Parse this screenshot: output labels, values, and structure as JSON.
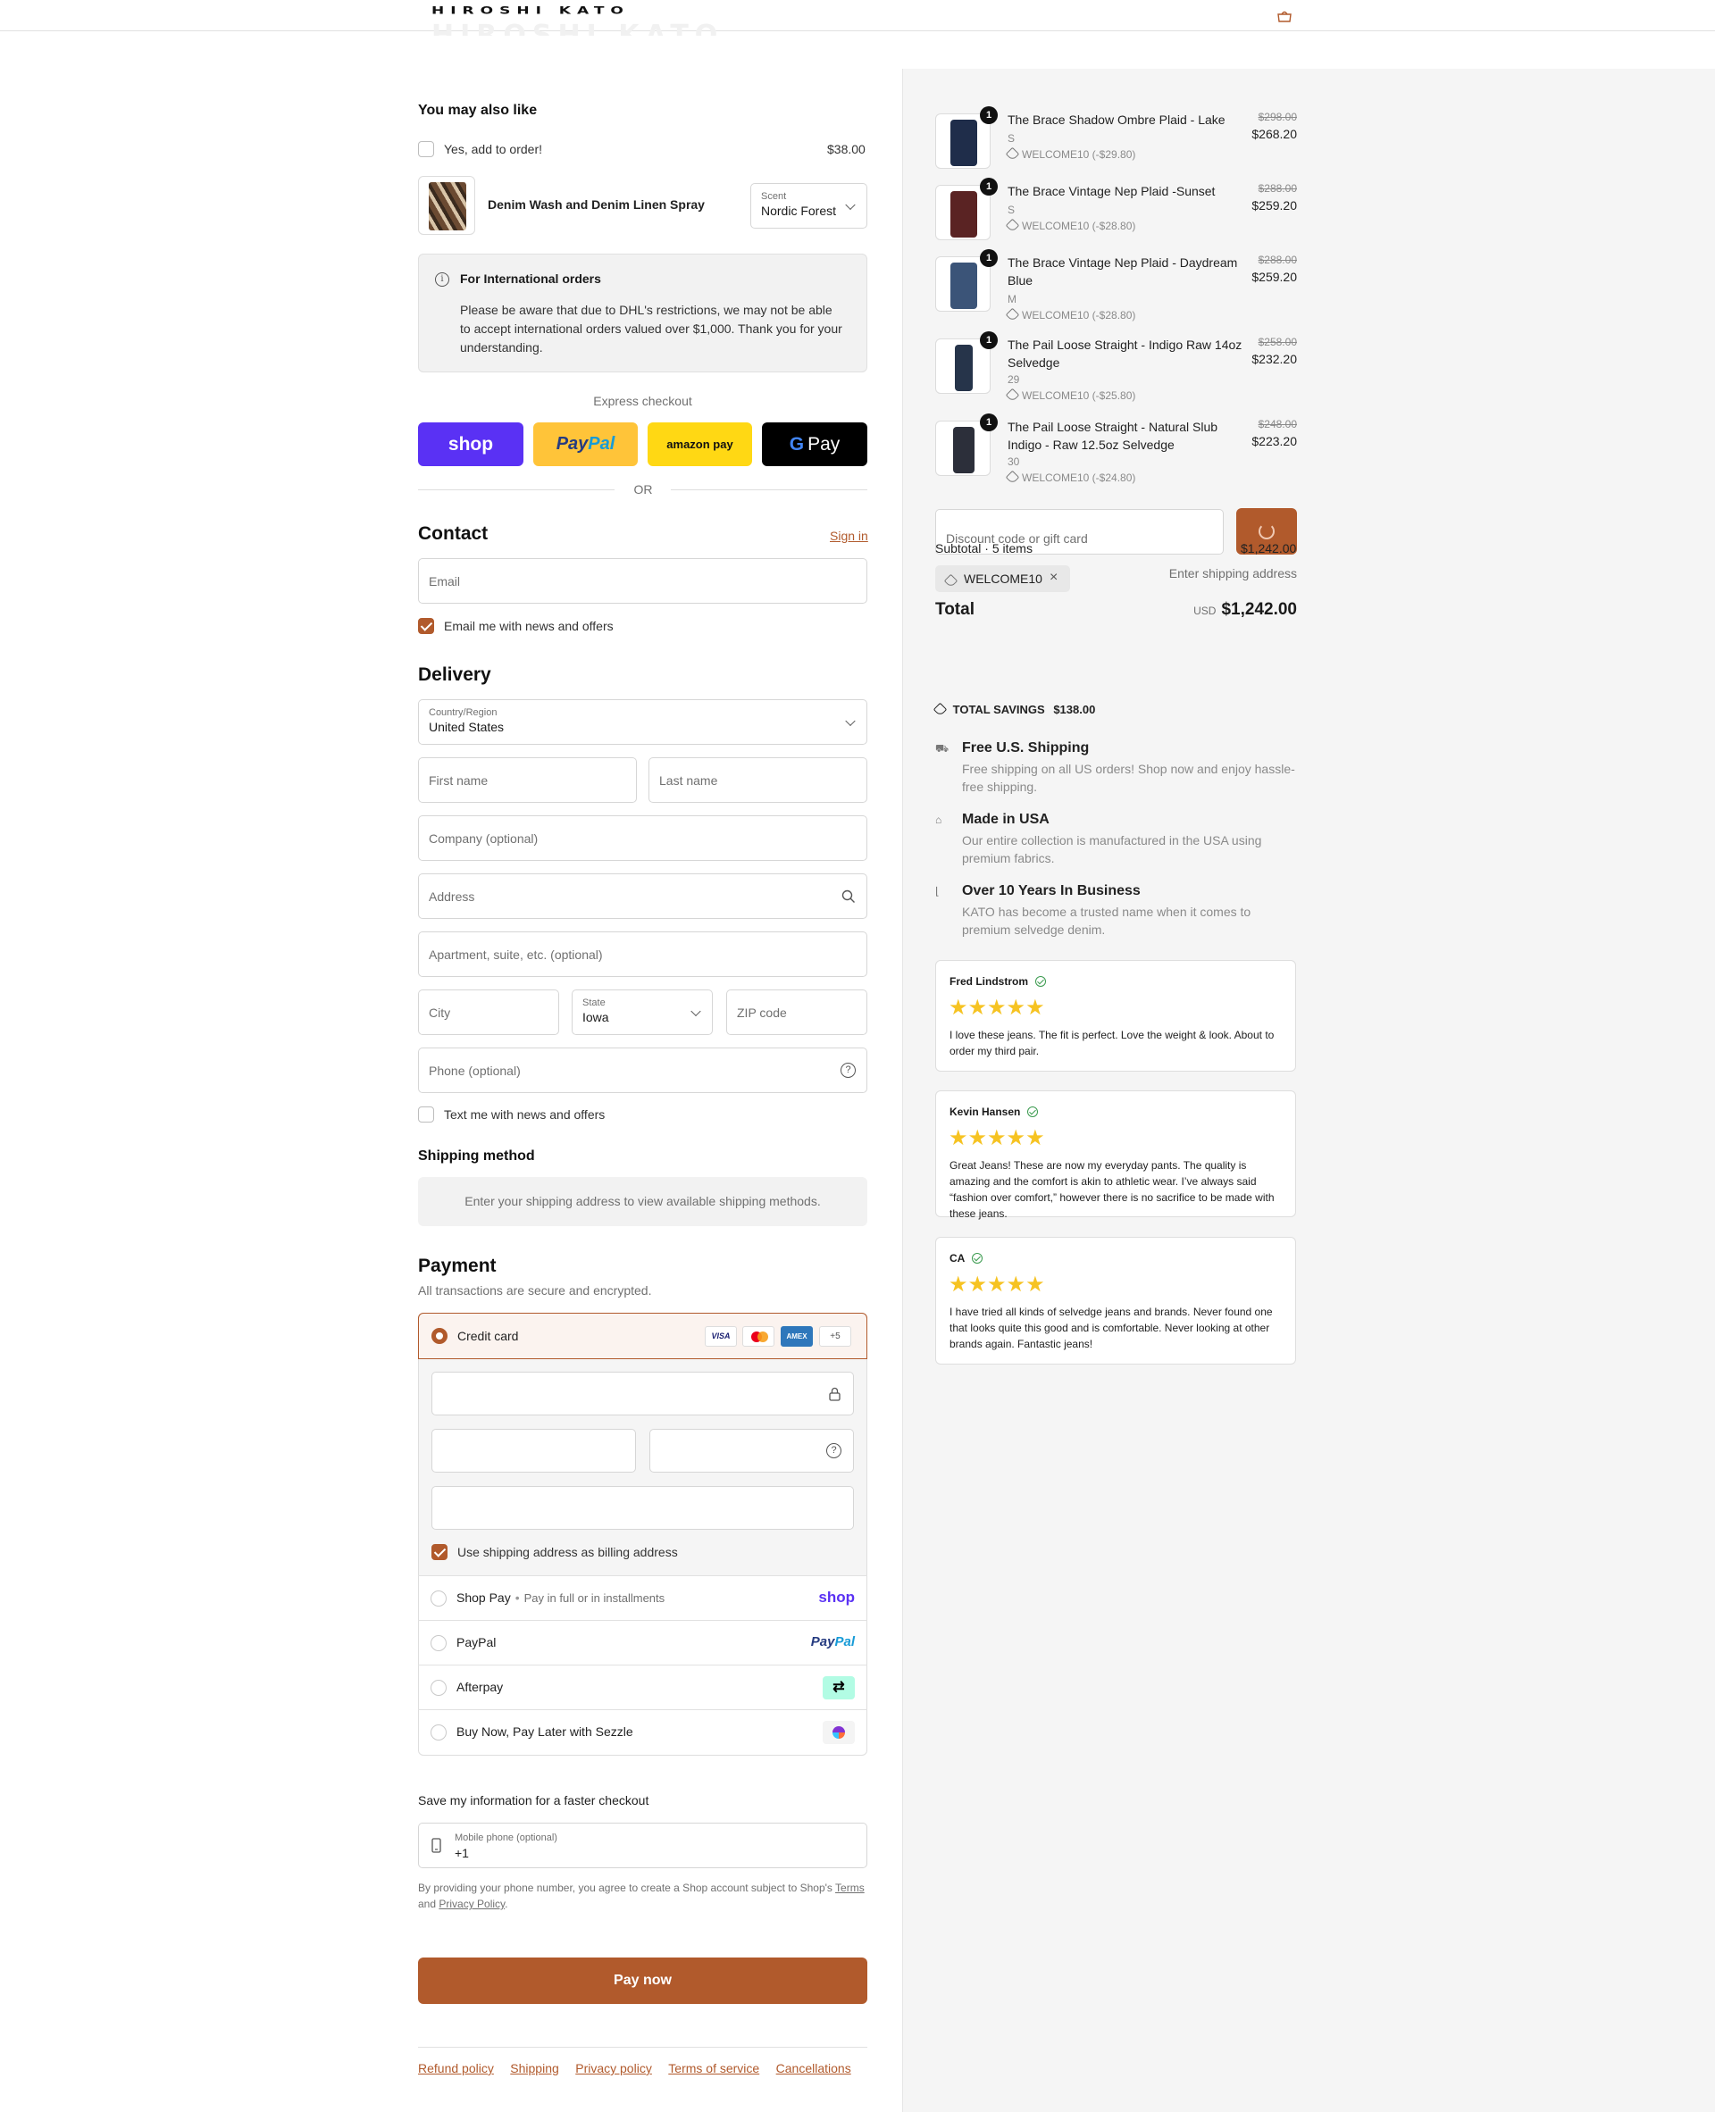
{
  "header": {
    "logo": "HIROSHI KATO",
    "logo_ghost": "HIROSHI KATO",
    "cart_icon": "bag-icon"
  },
  "upsell": {
    "title": "You may also like",
    "checkbox_label": "Yes, add to order!",
    "price": "$38.00",
    "product_name": "Denim Wash and Denim Linen Spray",
    "scent_label": "Scent",
    "scent_value": "Nordic Forest"
  },
  "notice": {
    "title": "For International orders",
    "body": "Please be aware that due to DHL's restrictions, we may not be able to accept international orders valued over $1,000. Thank you for your understanding."
  },
  "express": {
    "title": "Express checkout",
    "shop": "shop",
    "paypal_pay": "Pay",
    "paypal_pal": "Pal",
    "amazon": "amazon pay",
    "gpay_g": "G",
    "gpay": "Pay",
    "or": "OR"
  },
  "contact": {
    "title": "Contact",
    "sign_in": "Sign in",
    "email_placeholder": "Email",
    "news_label": "Email me with news and offers"
  },
  "delivery": {
    "title": "Delivery",
    "country_label": "Country/Region",
    "country_value": "United States",
    "first_name": "First name",
    "last_name": "Last name",
    "company": "Company (optional)",
    "address": "Address",
    "apartment": "Apartment, suite, etc. (optional)",
    "city": "City",
    "state_label": "State",
    "state_value": "Iowa",
    "zip": "ZIP code",
    "phone": "Phone (optional)",
    "text_label": "Text me with news and offers"
  },
  "shipping": {
    "title": "Shipping method",
    "message": "Enter your shipping address to view available shipping methods."
  },
  "payment": {
    "title": "Payment",
    "subtitle": "All transactions are secure and encrypted.",
    "credit_card": "Credit card",
    "cards": [
      "VISA",
      "MC",
      "AMEX",
      "+5"
    ],
    "billing_label": "Use shipping address as billing address",
    "shop_pay": "Shop Pay",
    "shop_pay_sub": "Pay in full or in installments",
    "shop_pay_logo": "shop",
    "paypal": "PayPal",
    "paypal_logo_pay": "Pay",
    "paypal_logo_pal": "Pal",
    "afterpay": "Afterpay",
    "sezzle": "Buy Now, Pay Later with Sezzle"
  },
  "save_info": {
    "title": "Save my information for a faster checkout",
    "mobile_label": "Mobile phone (optional)",
    "mobile_value": "+1",
    "legal_prefix": "By providing your phone number, you agree to create a Shop account subject to Shop's",
    "terms": "Terms",
    "and": "and",
    "privacy": "Privacy Policy",
    "period": "."
  },
  "pay_now": "Pay now",
  "footer_links": [
    "Refund policy",
    "Shipping",
    "Privacy policy",
    "Terms of service",
    "Cancellations"
  ],
  "order": {
    "items": [
      {
        "qty": "1",
        "name": "The Brace Shadow Ombre Plaid - Lake",
        "variant": "S",
        "discount": "WELCOME10 (-$29.80)",
        "old_price": "$298.00",
        "price": "$268.20",
        "color": "#1f2d4a"
      },
      {
        "qty": "1",
        "name": "The Brace Vintage Nep Plaid -Sunset",
        "variant": "S",
        "discount": "WELCOME10 (-$28.80)",
        "old_price": "$288.00",
        "price": "$259.20",
        "color": "#5a2323"
      },
      {
        "qty": "1",
        "name": "The Brace Vintage Nep Plaid - Daydream Blue",
        "variant": "M",
        "discount": "WELCOME10 (-$28.80)",
        "old_price": "$288.00",
        "price": "$259.20",
        "color": "#3b5478"
      },
      {
        "qty": "1",
        "name": "The Pail Loose Straight - Indigo Raw 14oz Selvedge",
        "variant": "29",
        "discount": "WELCOME10 (-$25.80)",
        "old_price": "$258.00",
        "price": "$232.20",
        "color": "#26344a"
      },
      {
        "qty": "1",
        "name": "The Pail Loose Straight - Natural Slub Indigo - Raw 12.5oz Selvedge",
        "variant": "30",
        "discount": "WELCOME10 (-$24.80)",
        "old_price": "$248.00",
        "price": "$223.20",
        "color": "#2c2f3a"
      }
    ],
    "discount_placeholder": "Discount code or gift card",
    "subtotal_label": "Subtotal · 5 items",
    "subtotal": "$1,242.00",
    "code": "WELCOME10",
    "shipping_hint": "Enter shipping address",
    "total_label": "Total",
    "currency": "USD",
    "total": "$1,242.00",
    "savings_label": "TOTAL SAVINGS",
    "savings": "$138.00"
  },
  "features": [
    {
      "title": "Free U.S. Shipping",
      "desc": "Free shipping on all US orders! Shop now and enjoy hassle-free shipping.",
      "icon": "truck-icon"
    },
    {
      "title": "Made in USA",
      "desc": "Our entire collection is manufactured in the USA using premium fabrics.",
      "icon": "factory-icon"
    },
    {
      "title": "Over 10 Years In Business",
      "desc": "KATO has become a trusted name when it comes to premium selvedge denim.",
      "icon": "boot-icon"
    }
  ],
  "reviews": [
    {
      "name": "Fred Lindstrom",
      "stars": "★★★★★",
      "body": "I love these jeans. The fit is perfect. Love the weight & look. About to order my third pair."
    },
    {
      "name": "Kevin Hansen",
      "stars": "★★★★★",
      "body": "Great Jeans! These are now my everyday pants. The quality is amazing and the comfort is akin to athletic wear. I’ve always said “fashion over comfort,” however there is no sacrifice to be made with these jeans."
    },
    {
      "name": "CA",
      "stars": "★★★★★",
      "body": "I have tried all kinds of selvedge jeans and brands. Never found one that looks quite this good and is comfortable. Never looking at other brands again. Fantastic jeans!"
    }
  ]
}
